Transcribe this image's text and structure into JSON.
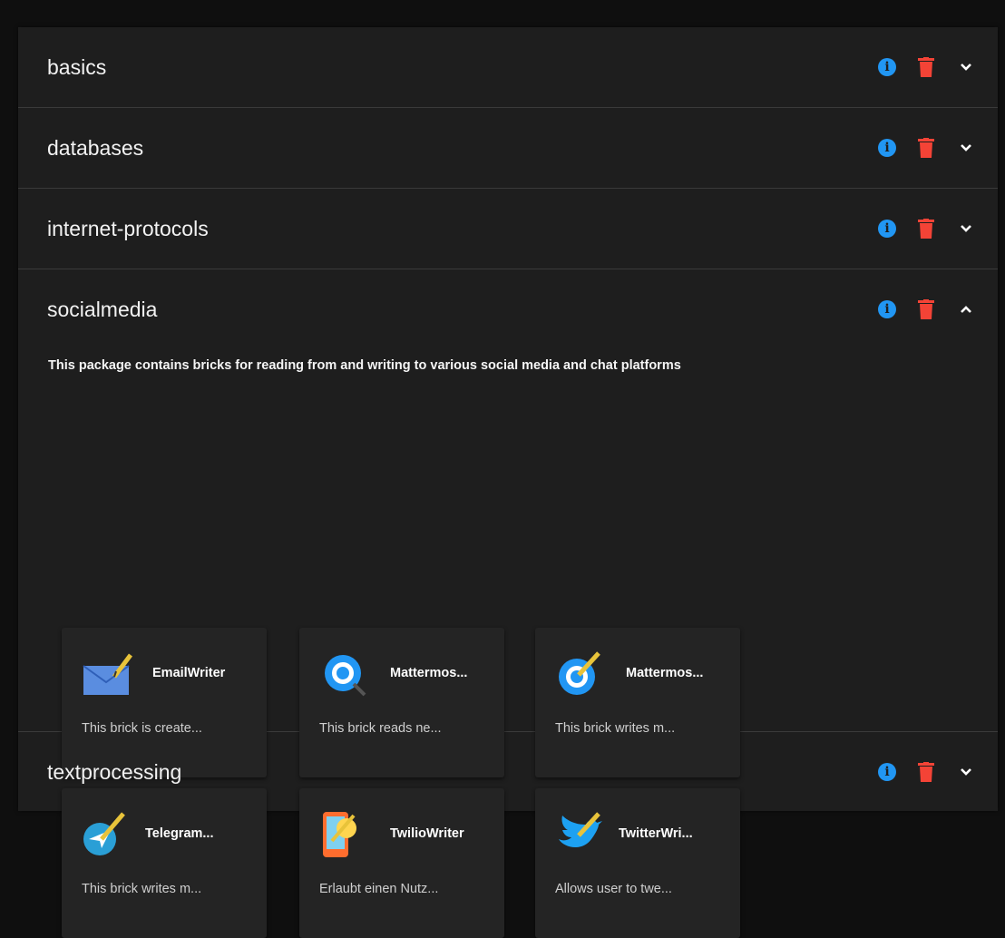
{
  "packages": [
    {
      "name": "basics",
      "expanded": false
    },
    {
      "name": "databases",
      "expanded": false
    },
    {
      "name": "internet-protocols",
      "expanded": false
    },
    {
      "name": "socialmedia",
      "expanded": true
    },
    {
      "name": "textprocessing",
      "expanded": false
    }
  ],
  "socialmedia": {
    "description": "This package contains bricks for reading from and writing to various social media and chat platforms",
    "bricks": [
      {
        "name": "EmailWriter",
        "summary": "This brick is create...",
        "icon": "email-icon"
      },
      {
        "name": "Mattermos...",
        "summary": "This brick reads ne...",
        "icon": "mattermost-reader-icon"
      },
      {
        "name": "Mattermos...",
        "summary": "This brick writes m...",
        "icon": "mattermost-writer-icon"
      },
      {
        "name": "Telegram...",
        "summary": "This brick writes m...",
        "icon": "telegram-icon"
      },
      {
        "name": "TwilioWriter",
        "summary": "Erlaubt einen Nutz...",
        "icon": "twilio-icon"
      },
      {
        "name": "TwitterWri...",
        "summary": "Allows user to twe...",
        "icon": "twitter-icon"
      }
    ]
  },
  "colors": {
    "info": "#2196f3",
    "delete": "#f44336",
    "background": "#1e1e1e"
  }
}
